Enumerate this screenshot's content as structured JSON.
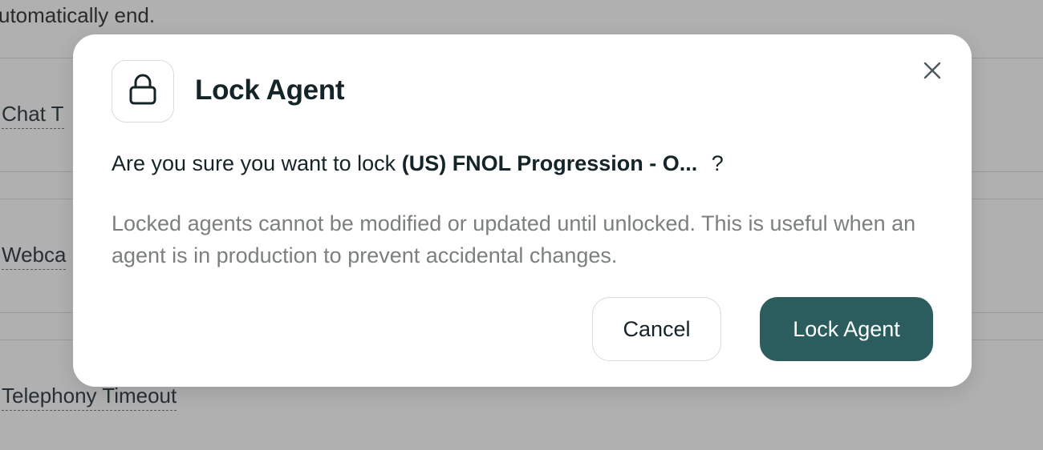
{
  "background": {
    "partial_text": "utomatically end.",
    "labels": [
      "Chat T",
      "Webca",
      "Telephony Timeout"
    ]
  },
  "modal": {
    "title": "Lock Agent",
    "icon": "lock-icon",
    "close_icon": "close-icon",
    "question_prefix": "Are you sure you want to lock",
    "agent_name": "(US) FNOL Progression - O...",
    "question_suffix": "?",
    "description": "Locked agents cannot be modified or updated until unlocked. This is useful when an agent is in production to prevent accidental changes.",
    "cancel_label": "Cancel",
    "confirm_label": "Lock Agent"
  },
  "colors": {
    "overlay": "#b0b0b0",
    "primary": "#2b5d5e",
    "title_text": "#152428",
    "muted_text": "#7b7f80"
  }
}
